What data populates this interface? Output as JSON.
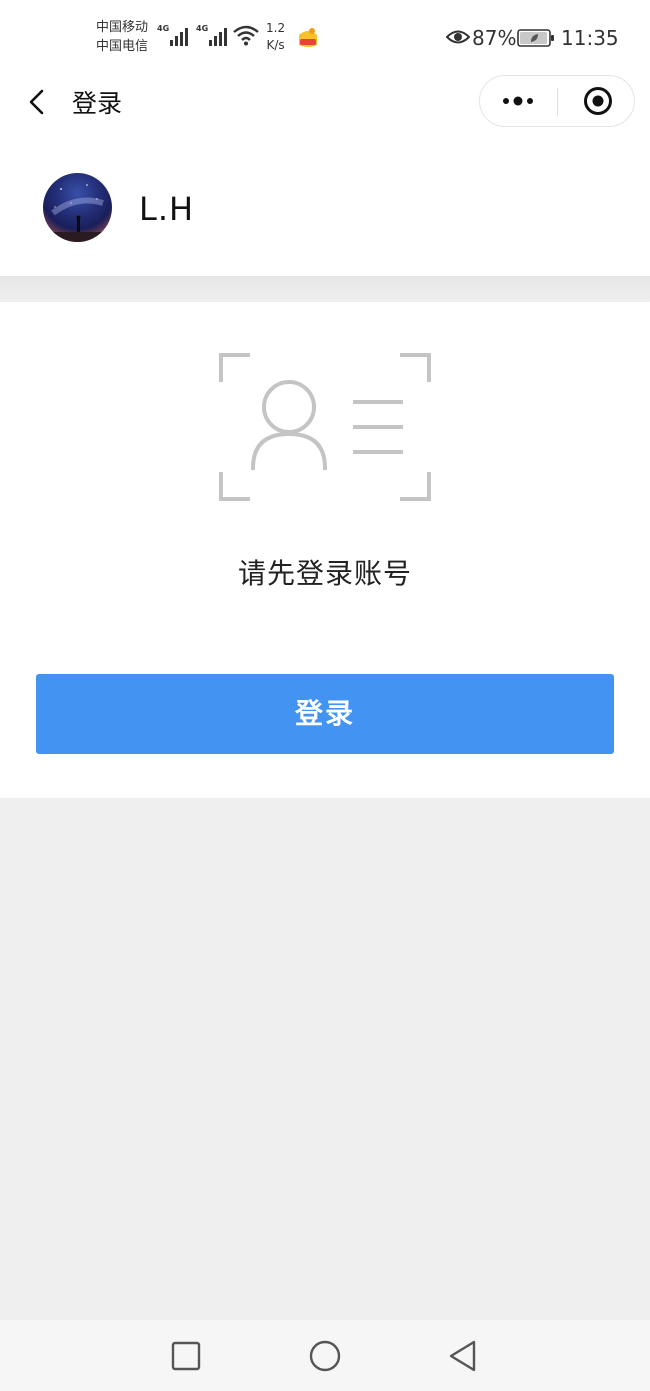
{
  "status_bar": {
    "carrier_1": "中国移动",
    "carrier_2": "中国电信",
    "network_1": "4G",
    "network_2": "4G",
    "speed_value": "1.2",
    "speed_unit": "K/s",
    "battery_percent": "87%",
    "time": "11:35",
    "icons": [
      "signal-icon",
      "wifi-icon",
      "app-notification-icon",
      "eye-icon",
      "battery-icon"
    ]
  },
  "nav": {
    "title": "登录",
    "icons": [
      "back-icon",
      "more-icon",
      "close-target-icon"
    ]
  },
  "user": {
    "name": "L.H"
  },
  "main": {
    "prompt": "请先登录账号",
    "login_button": "登录",
    "icons": [
      "id-card-icon"
    ]
  },
  "system_nav": {
    "icons": [
      "recent-apps-icon",
      "home-icon",
      "back-triangle-icon"
    ]
  },
  "colors": {
    "primary_button": "#4293f2",
    "page_background": "#efefef",
    "icon_gray": "#c4c4c4"
  }
}
